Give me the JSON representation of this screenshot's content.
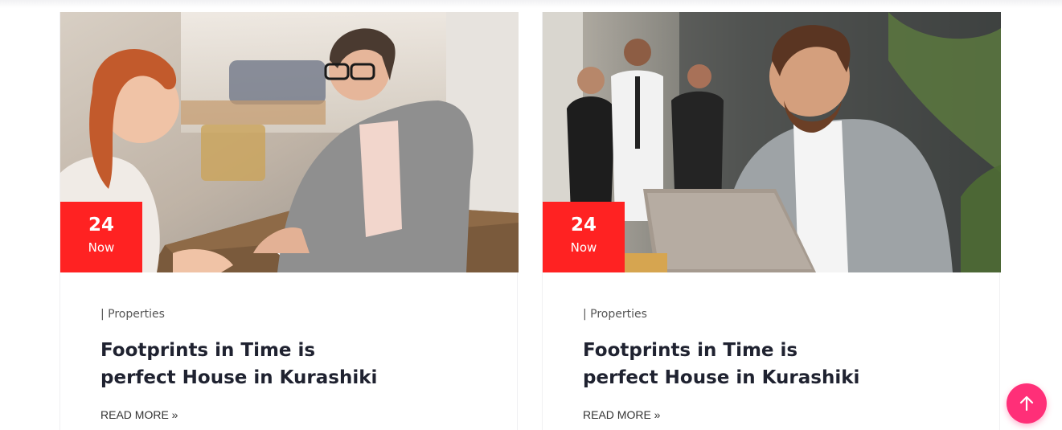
{
  "posts": [
    {
      "date_day": "24",
      "date_month": "Now",
      "category": "| Properties",
      "title": "Footprints in Time is perfect House in Kurashiki",
      "read_more": "READ MORE »"
    },
    {
      "date_day": "24",
      "date_month": "Now",
      "category": "| Properties",
      "title": "Footprints in Time is perfect House in Kurashiki",
      "read_more": "READ MORE »"
    }
  ],
  "colors": {
    "badge": "#ff2222",
    "back_to_top": "#ff2f78",
    "title": "#1f2230"
  },
  "icons": {
    "back_to_top": "arrow-up-icon"
  }
}
